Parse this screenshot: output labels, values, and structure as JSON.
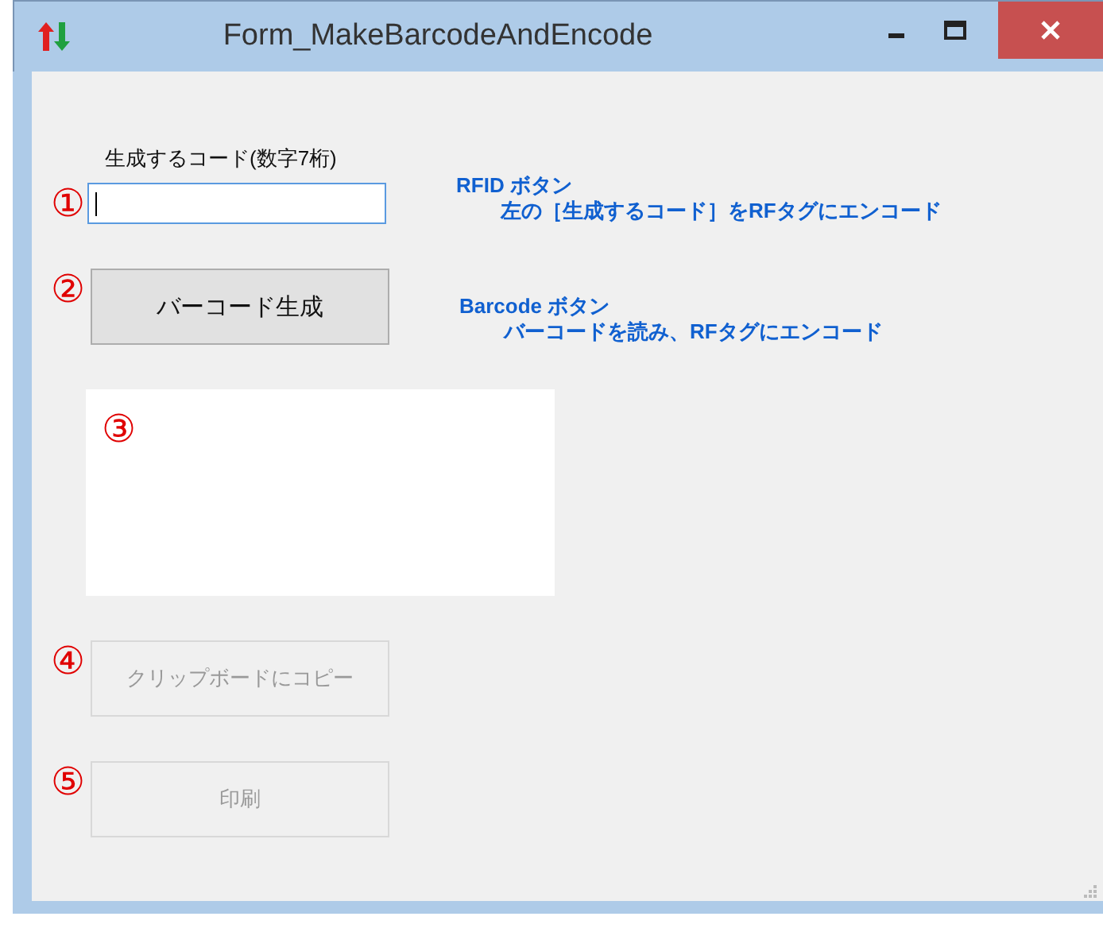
{
  "window": {
    "title": "Form_MakeBarcodeAndEncode"
  },
  "code_field": {
    "marker": "①",
    "label": "生成するコード(数字7桁)",
    "focused": true
  },
  "notes": [
    {
      "title": "RFID ボタン",
      "text": "左の［生成するコード］をRFタグにエンコード"
    },
    {
      "title": "Barcode ボタン",
      "text": "バーコードを読み、RFタグにエンコード"
    }
  ],
  "generate_button": {
    "marker": "②",
    "label": "バーコード生成",
    "disabled": false
  },
  "barcode_box": {
    "marker": "③"
  },
  "buttons": [
    {
      "marker": "④",
      "label": "クリップボードにコピー",
      "disabled": true
    },
    {
      "marker": "⑤",
      "label": "印刷",
      "disabled": true
    }
  ]
}
